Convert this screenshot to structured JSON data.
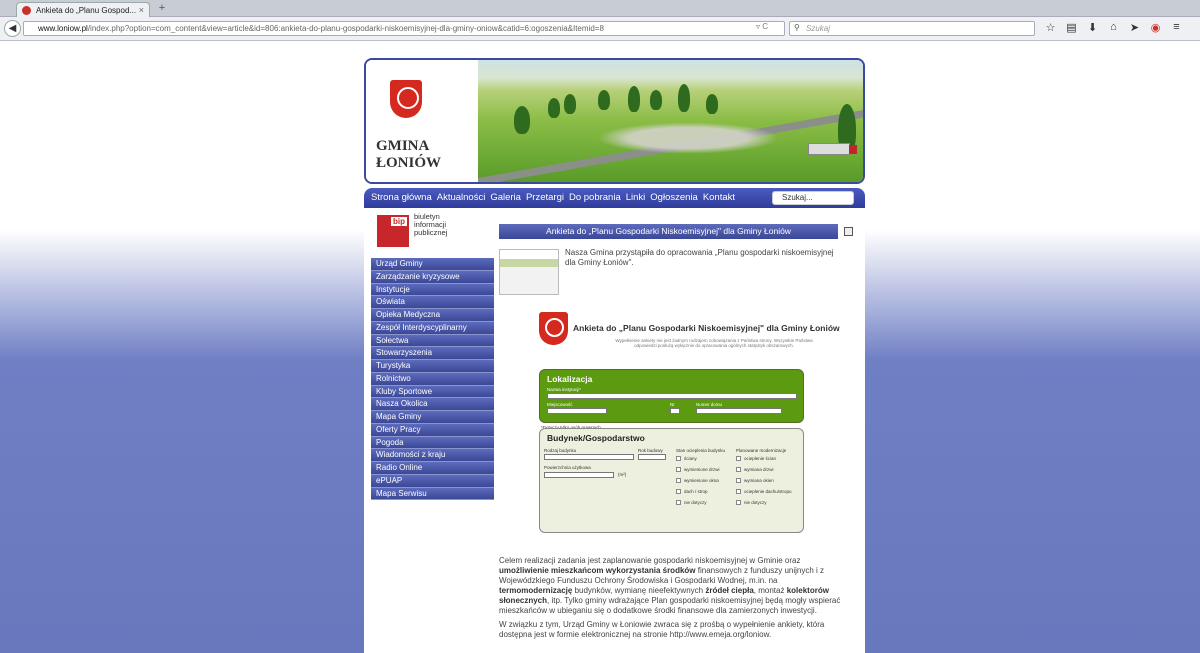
{
  "browser": {
    "tab_title": "Ankieta do „Planu Gospod...",
    "tab_close": "×",
    "new_tab": "+",
    "url_host": "www.loniow.pl",
    "url_path": "/index.php?option=com_content&view=article&id=806:ankieta-do-planu-gospodarki-niskoemisyjnej-dla-gminy-oniow&catid=6:ogoszenia&Itemid=8",
    "url_tools": "▿ C",
    "search_placeholder": "Szukaj",
    "icons": [
      "back-arrow-icon",
      "star-icon",
      "clipboard-icon",
      "download-icon",
      "home-icon",
      "send-icon",
      "pocket-icon",
      "menu-icon"
    ]
  },
  "site": {
    "gmina_line1": "GMINA",
    "gmina_line2": "ŁONIÓW",
    "accent": "#3b4a9c"
  },
  "menu": {
    "items": [
      "Strona główna",
      "Aktualności",
      "Galeria",
      "Przetargi",
      "Do pobrania",
      "Linki",
      "Ogłoszenia",
      "Kontakt"
    ],
    "search_value": "Szukaj..."
  },
  "bip": {
    "tag": "bip",
    "line1": "biuletyn",
    "line2": "informacji publicznej"
  },
  "sidebar": {
    "items": [
      "Urząd Gminy",
      "Zarządzanie kryzysowe",
      "Instytucje",
      "Oświata",
      "Opieka Medyczna",
      "Zespół Interdyscyplinarny",
      "Sołectwa",
      "Stowarzyszenia",
      "Turystyka",
      "Rolnictwo",
      "Kluby Sportowe",
      "Nasza Okolica",
      "Mapa Gminy",
      "Oferty Pracy",
      "Pogoda",
      "Wiadomości z kraju",
      "Radio Online",
      "ePUAP",
      "Mapa Serwisu"
    ]
  },
  "article": {
    "title": "Ankieta do „Planu Gospodarki Niskoemisyjnej\" dla Gminy Łoniów",
    "intro": "Nasza Gmina przystąpiła do opracowania „Planu gospodarki niskoemisyjnej dla Gminy Łoniów\".",
    "form_title": "Ankieta do „Planu Gospodarki Niskoemisyjnej\" dla Gminy Łoniów",
    "form_subtitle": "Wypełnienie ankiety nie jest żadnym rodzajem zobowiązania z Państwa strony. Wszystkie Państwa odpowiedzi posłużą wyłącznie do opracowania ogólnych statystyk obszarowych.",
    "section1": "Lokalizacja",
    "section1_labels": [
      "Nazwa instytucji*",
      "Miejscowość",
      "Nr",
      "Numer domu",
      "*Dotyczy tylko osób prawnych"
    ],
    "section2": "Budynek/Gospodarstwo",
    "section2_labels": [
      "Rodzaj budynku",
      "Rok budowy",
      "Stan ocieplenia budynku",
      "Planowane modernizacje",
      "Powierzchnia użytkowa",
      "(m²)"
    ],
    "state_options": [
      "ściany",
      "wymienione drzwi",
      "wymienione okna",
      "dach / strop",
      "nie dotyczy"
    ],
    "plan_options": [
      "ocieplenie ścian",
      "wymiana drzwi",
      "wymiana okien",
      "ocieplenie dachu/stropu",
      "nie dotyczy"
    ],
    "para1_a": "Celem realizacji zadania jest zaplanowanie gospodarki niskoemisyjnej w Gminie oraz ",
    "para1_b": "umożliwienie mieszkańcom wykorzystania środków",
    "para1_c": " finansowych z funduszy unijnych i z Wojewódzkiego Funduszu Ochrony Środowiska i Gospodarki Wodnej, m.in. na ",
    "para1_d": "termomodernizację",
    "para1_e": " budynków, wymianę nieefektywnych ",
    "para1_f": "źródeł ciepła",
    "para1_g": ", montaż ",
    "para1_h": "kolektorów słonecznych",
    "para1_i": ", itp. Tylko gminy wdrażające Plan gospodarki niskoemisyjnej będą mogły wspierać mieszkańców w ubieganiu się o dodatkowe środki finansowe dla zamierzonych inwestycji.",
    "para2": "W związku z tym, Urząd Gminy w Łoniowie zwraca się z prośbą o wypełnienie ankiety, która dostępna jest w formie elektronicznej na stronie http://www.emeja.org/loniow."
  }
}
